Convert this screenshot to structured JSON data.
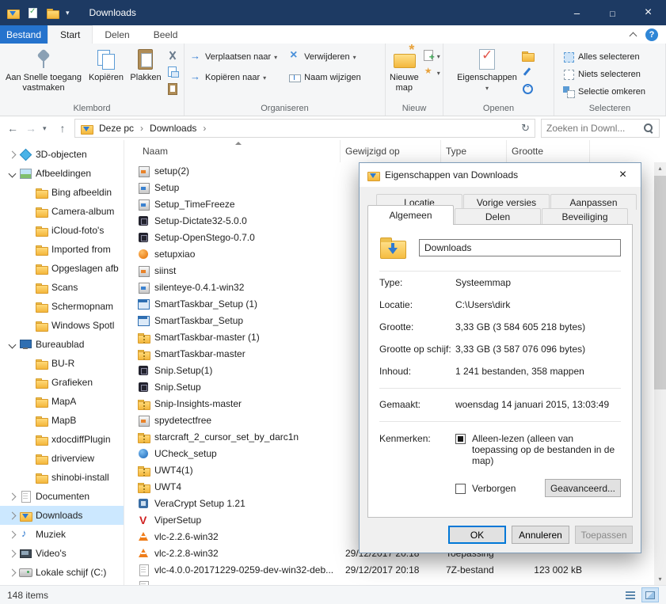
{
  "colors": {
    "titlebar": "#1d3a63",
    "filetab": "#2573cd",
    "accent": "#0078d7",
    "selection": "#cce8ff",
    "ribbonbg": "#f5f6f7"
  },
  "icons": {
    "window": "downloads-folder",
    "search": "magnifier",
    "help": "question-circle",
    "sort": "up-triangle"
  },
  "titlebar": {
    "title": "Downloads"
  },
  "ribbon": {
    "file_tab": "Bestand",
    "tabs": [
      {
        "label": "Start",
        "active": true
      },
      {
        "label": "Delen"
      },
      {
        "label": "Beeld"
      }
    ],
    "groups": {
      "klembord": {
        "label": "Klembord",
        "pin": "Aan Snelle toegang vastmaken",
        "copy": "Kopiëren",
        "paste": "Plakken"
      },
      "organiseren": {
        "label": "Organiseren",
        "move_to": "Verplaatsen naar",
        "copy_to": "Kopiëren naar",
        "delete": "Verwijderen",
        "rename": "Naam wijzigen"
      },
      "nieuw": {
        "label": "Nieuw",
        "new_folder": "Nieuwe map"
      },
      "openen": {
        "label": "Openen",
        "properties": "Eigenschappen"
      },
      "selecteren": {
        "label": "Selecteren",
        "select_all": "Alles selecteren",
        "select_none": "Niets selecteren",
        "invert": "Selectie omkeren"
      }
    }
  },
  "addressbar": {
    "breadcrumb": [
      "Deze pc",
      "Downloads"
    ],
    "search_placeholder": "Zoeken in Downl..."
  },
  "sidebar": {
    "items": [
      {
        "label": "3D-objecten",
        "icon": "cube",
        "level": 1,
        "chev": "r"
      },
      {
        "label": "Afbeeldingen",
        "icon": "pictures",
        "level": 1,
        "chev": "d"
      },
      {
        "label": "Bing afbeeldin",
        "icon": "folder",
        "level": 2
      },
      {
        "label": "Camera-album",
        "icon": "folder",
        "level": 2
      },
      {
        "label": "iCloud-foto's",
        "icon": "folder",
        "level": 2
      },
      {
        "label": "Imported from",
        "icon": "folder",
        "level": 2
      },
      {
        "label": "Opgeslagen afb",
        "icon": "folder",
        "level": 2
      },
      {
        "label": "Scans",
        "icon": "folder",
        "level": 2
      },
      {
        "label": "Schermopnam",
        "icon": "folder",
        "level": 2
      },
      {
        "label": "Windows Spotl",
        "icon": "folder",
        "level": 2
      },
      {
        "label": "Bureaublad",
        "icon": "desktop",
        "level": 1,
        "chev": "d"
      },
      {
        "label": "BU-R",
        "icon": "folder",
        "level": 2
      },
      {
        "label": "Grafieken",
        "icon": "folder",
        "level": 2
      },
      {
        "label": "MapA",
        "icon": "folder",
        "level": 2
      },
      {
        "label": "MapB",
        "icon": "folder",
        "level": 2
      },
      {
        "label": "xdocdiffPlugin",
        "icon": "folder",
        "level": 2
      },
      {
        "label": "driverview",
        "icon": "folder",
        "level": 2
      },
      {
        "label": "shinobi-install",
        "icon": "folder",
        "level": 2
      },
      {
        "label": "Documenten",
        "icon": "documents",
        "level": 1,
        "chev": "r"
      },
      {
        "label": "Downloads",
        "icon": "downloads",
        "level": 1,
        "chev": "r",
        "selected": true
      },
      {
        "label": "Muziek",
        "icon": "music",
        "level": 1,
        "chev": "r"
      },
      {
        "label": "Video's",
        "icon": "videos",
        "level": 1,
        "chev": "r"
      },
      {
        "label": "Lokale schijf (C:)",
        "icon": "drive",
        "level": 1,
        "chev": "r"
      }
    ]
  },
  "filelist": {
    "columns": [
      "Naam",
      "Gewijzigd op",
      "Type",
      "Grootte"
    ],
    "rows": [
      {
        "name": "setup(2)",
        "icon": "installer"
      },
      {
        "name": "Setup",
        "icon": "installer2"
      },
      {
        "name": "Setup_TimeFreeze",
        "icon": "installer2"
      },
      {
        "name": "Setup-Dictate32-5.0.0",
        "icon": "app-dark"
      },
      {
        "name": "Setup-OpenStego-0.7.0",
        "icon": "app-dark"
      },
      {
        "name": "setupxiao",
        "icon": "ball-orange"
      },
      {
        "name": "siinst",
        "icon": "installer"
      },
      {
        "name": "silenteye-0.4.1-win32",
        "icon": "installer2"
      },
      {
        "name": "SmartTaskbar_Setup (1)",
        "icon": "window"
      },
      {
        "name": "SmartTaskbar_Setup",
        "icon": "window"
      },
      {
        "name": "SmartTaskbar-master (1)",
        "icon": "zip"
      },
      {
        "name": "SmartTaskbar-master",
        "icon": "zip"
      },
      {
        "name": "Snip.Setup(1)",
        "icon": "app-dark"
      },
      {
        "name": "Snip.Setup",
        "icon": "app-dark"
      },
      {
        "name": "Snip-Insights-master",
        "icon": "zip"
      },
      {
        "name": "spydetectfree",
        "icon": "installer"
      },
      {
        "name": "starcraft_2_cursor_set_by_darc1n",
        "icon": "zip"
      },
      {
        "name": "UCheck_setup",
        "icon": "ball-blue"
      },
      {
        "name": "UWT4(1)",
        "icon": "zip"
      },
      {
        "name": "UWT4",
        "icon": "zip"
      },
      {
        "name": "VeraCrypt Setup 1.21",
        "icon": "app-blue"
      },
      {
        "name": "ViperSetup",
        "icon": "v-red"
      },
      {
        "name": "vlc-2.2.6-win32",
        "icon": "vlc"
      },
      {
        "name": "vlc-2.2.8-win32",
        "icon": "vlc",
        "modified": "29/12/2017 20:18",
        "type": "Toepassing"
      },
      {
        "name": "vlc-4.0.0-20171229-0259-dev-win32-deb...",
        "icon": "doc",
        "modified": "29/12/2017 20:18",
        "type": "7Z-bestand",
        "size": "123 002 kB"
      },
      {
        "name": "",
        "icon": "doc"
      }
    ]
  },
  "dialog": {
    "title": "Eigenschappen van Downloads",
    "tabs_back": [
      {
        "label": "Locatie"
      },
      {
        "label": "Vorige versies"
      },
      {
        "label": "Aanpassen"
      }
    ],
    "tabs_front": [
      {
        "label": "Algemeen",
        "active": true
      },
      {
        "label": "Delen"
      },
      {
        "label": "Beveiliging"
      }
    ],
    "name_value": "Downloads",
    "fields": [
      {
        "label": "Type:",
        "value": "Systeemmap"
      },
      {
        "label": "Locatie:",
        "value": "C:\\Users\\dirk"
      },
      {
        "label": "Grootte:",
        "value": "3,33 GB (3 584 605 218 bytes)"
      },
      {
        "label": "Grootte op schijf:",
        "value": "3,33 GB (3 587 076 096 bytes)"
      },
      {
        "label": "Inhoud:",
        "value": "1 241 bestanden, 358 mappen"
      }
    ],
    "created_label": "Gemaakt:",
    "created_value": "woensdag 14 januari 2015, 13:03:49",
    "attrs_label": "Kenmerken:",
    "readonly_label": "Alleen-lezen (alleen van toepassing op de bestanden in de map)",
    "hidden_label": "Verborgen",
    "advanced_button": "Geavanceerd...",
    "ok": "OK",
    "cancel": "Annuleren",
    "apply": "Toepassen"
  },
  "statusbar": {
    "items_count": "148 items"
  }
}
